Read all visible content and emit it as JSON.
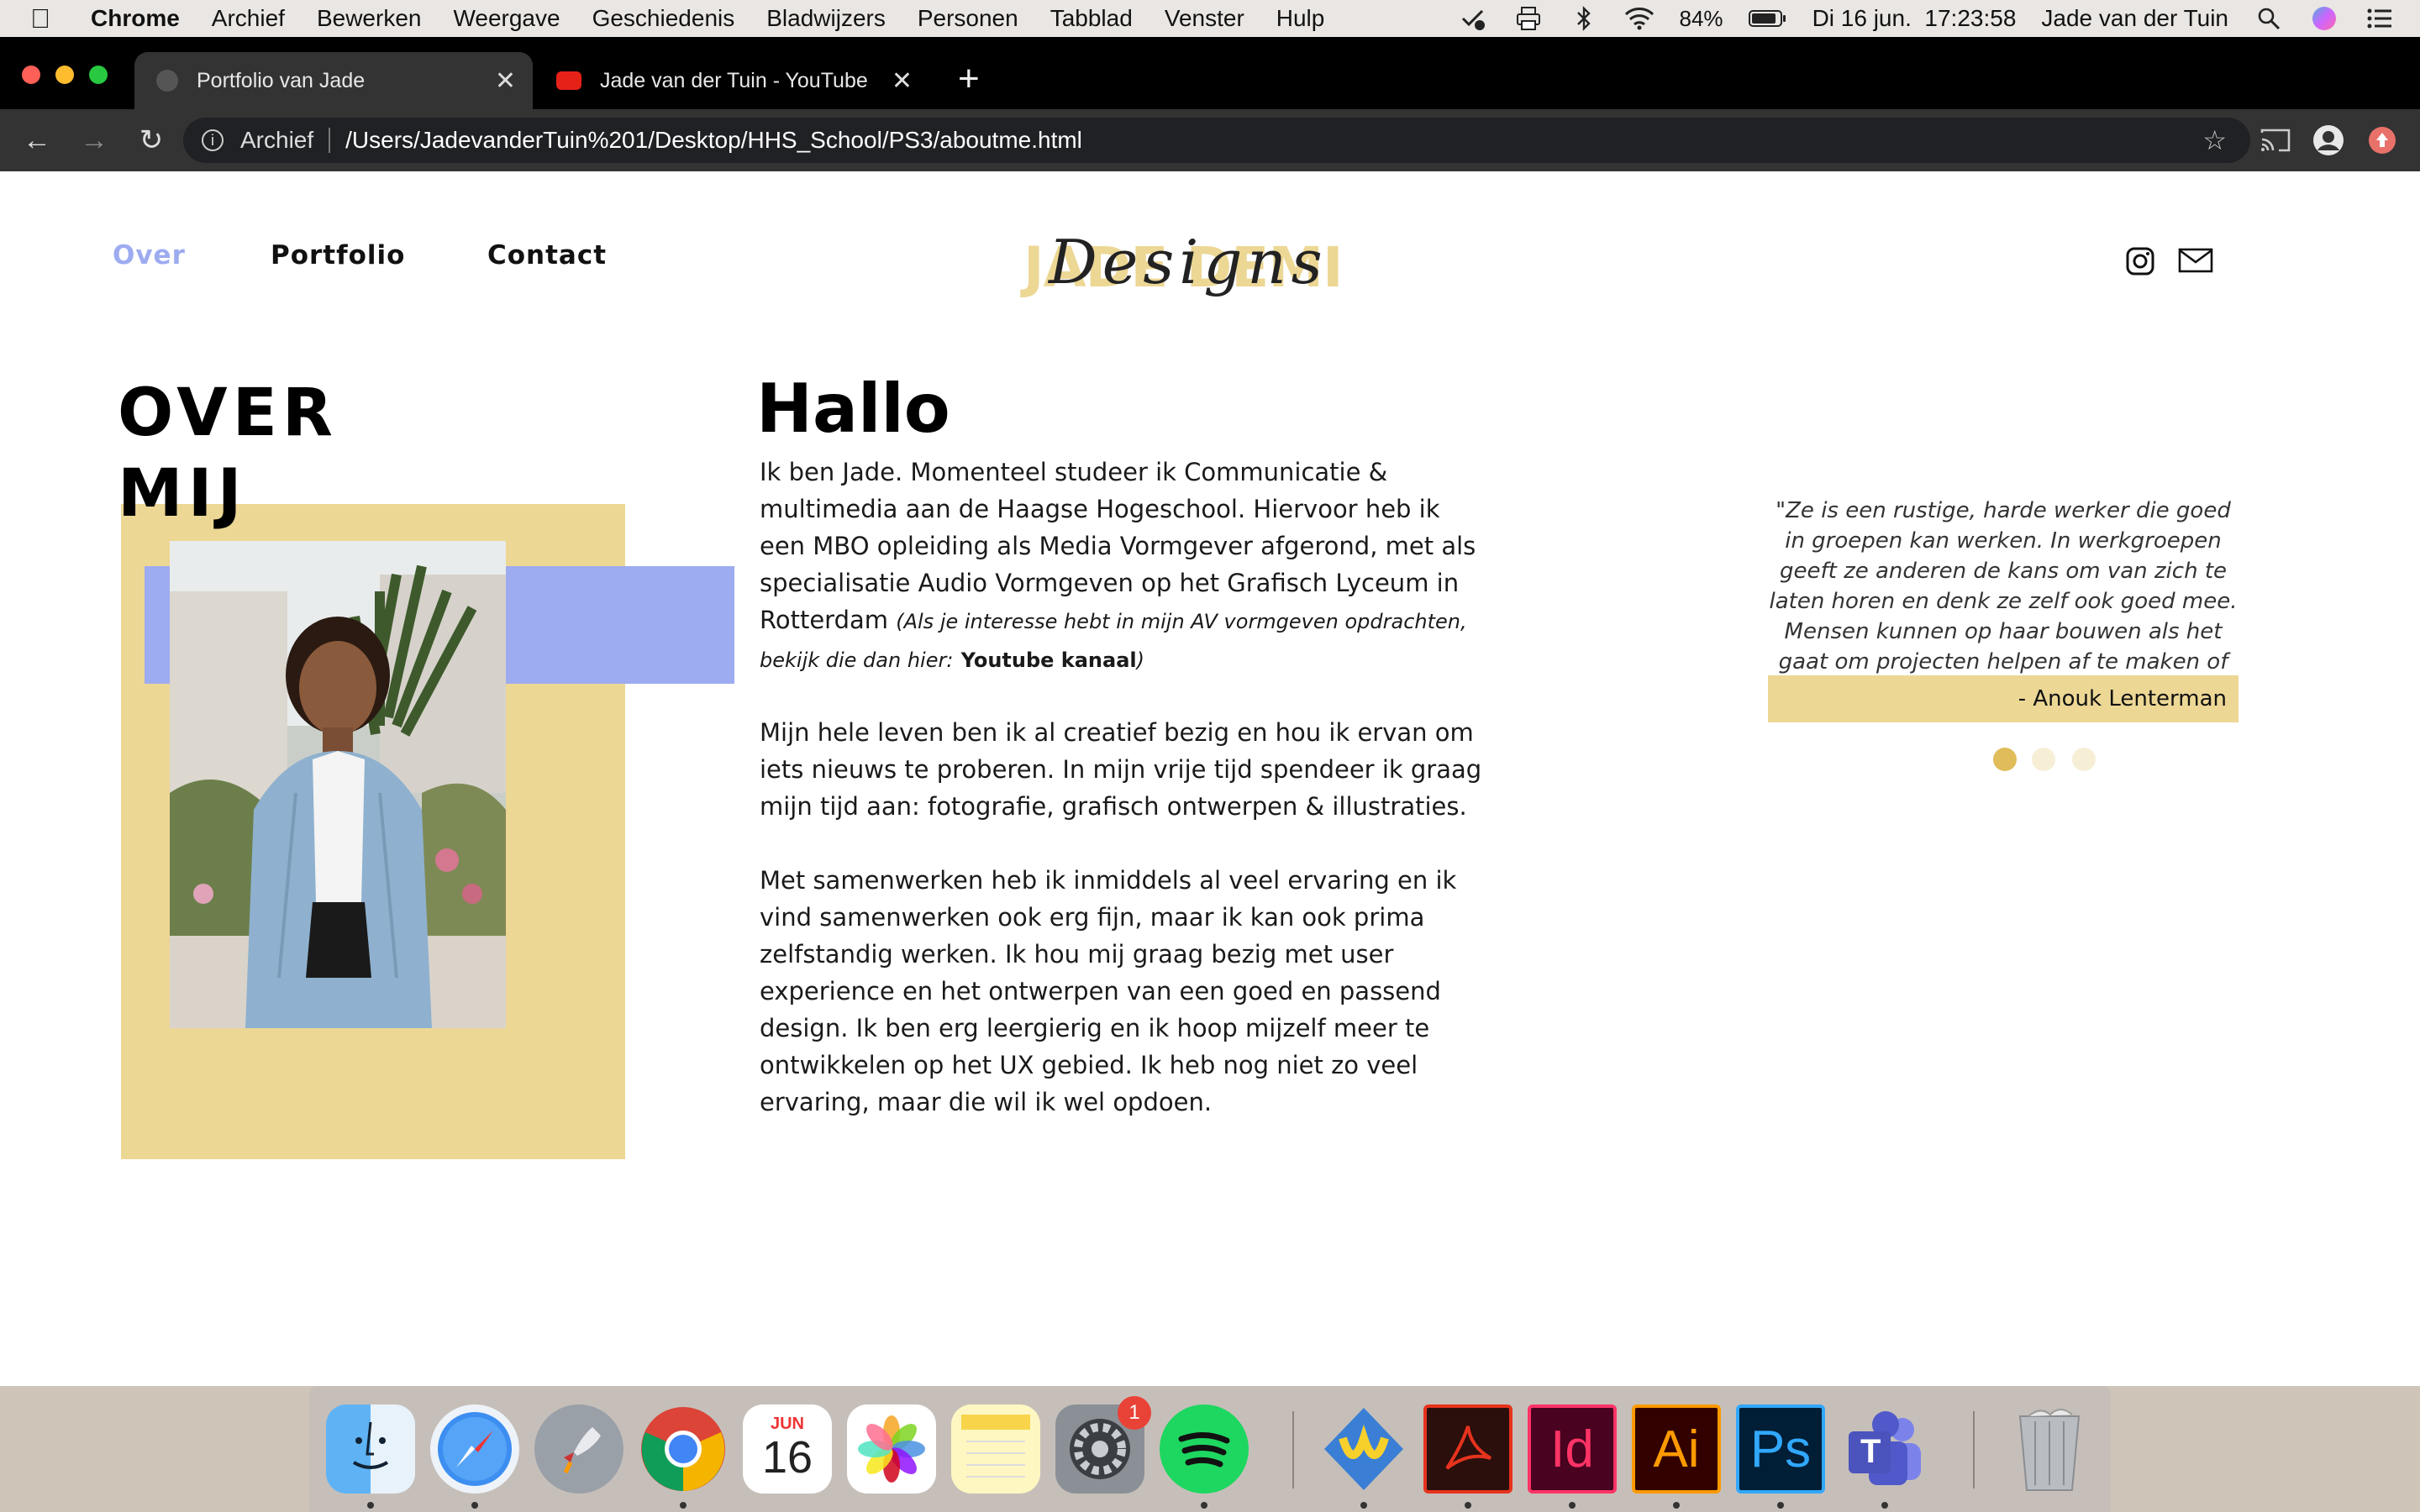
{
  "menubar": {
    "app": "Chrome",
    "items": [
      "Archief",
      "Bewerken",
      "Weergave",
      "Geschiedenis",
      "Bladwijzers",
      "Personen",
      "Tabblad",
      "Venster",
      "Hulp"
    ],
    "battery": "84%",
    "datetime": "Di 16 jun.  17:23:58",
    "user": "Jade van der Tuin"
  },
  "browser": {
    "tabs": [
      {
        "title": "Portfolio van Jade",
        "active": true
      },
      {
        "title": "Jade van der Tuin - YouTube",
        "active": false
      }
    ],
    "address": {
      "label": "Archief",
      "url": "/Users/JadevanderTuin%201/Desktop/HHS_School/PS3/aboutme.html"
    }
  },
  "site": {
    "nav": {
      "over": "Over",
      "portfolio": "Portfolio",
      "contact": "Contact"
    },
    "logo": {
      "back": "JADE DEMI",
      "script": "Designs"
    },
    "about": {
      "heading_line1": "OVER",
      "heading_line2": "MIJ",
      "greeting": "Hallo",
      "intro": "Ik ben Jade. Momenteel studeer ik Communicatie & multimedia aan de Haagse Hogeschool. Hiervoor heb ik een MBO opleiding als Media Vormgever afgerond, met als specialisatie Audio Vormgeven op het Grafisch Lyceum in Rotterdam",
      "note": "(Als je interesse hebt in mijn AV vormgeven opdrachten, bekijk die dan hier:",
      "youtube_link": "Youtube kanaal",
      "note_end": ")",
      "paragraph2": "Mijn hele leven ben ik al creatief bezig en hou ik ervan om iets nieuws te proberen. In mijn vrije tijd spendeer ik graag mijn tijd aan: fotografie, grafisch ontwerpen & illustraties.",
      "paragraph3": "Met samenwerken heb ik inmiddels al veel ervaring en ik vind samenwerken ook erg fijn, maar ik kan ook prima zelfstandig werken. Ik hou mij graag bezig met user experience en het ontwerpen van een goed en passend design. Ik ben erg leergierig en ik hoop mijzelf meer te ontwikkelen op het UX gebied. Ik heb nog niet zo veel ervaring, maar die wil ik wel opdoen."
    },
    "testimonial": {
      "quote": "\"Ze is een rustige, harde werker die goed in groepen kan werken. In werkgroepen geeft ze anderen de kans om van zich te laten horen en denk ze zelf ook goed mee. Mensen kunnen op haar bouwen als het gaat om projecten helpen af te maken of deadlines te halen.\"",
      "author": "- Anouk Lenterman",
      "active_index": 0,
      "count": 3
    }
  },
  "dock": {
    "calendar_month": "JUN",
    "calendar_day": "16",
    "preferences_badge": "1",
    "apps": [
      "finder-icon",
      "safari-icon",
      "launchpad-icon",
      "chrome-icon",
      "calendar-icon",
      "photos-icon",
      "notes-icon",
      "system-preferences-icon",
      "spotify-icon",
      "jedit-icon",
      "acrobat-icon",
      "indesign-icon",
      "illustrator-icon",
      "photoshop-icon",
      "teams-icon",
      "trash-icon"
    ],
    "labels": {
      "indesign": "Id",
      "illustrator": "Ai",
      "photoshop": "Ps",
      "teams": "T"
    }
  },
  "colors": {
    "accent_yellow": "#ecd795",
    "accent_blue": "#9dabf0",
    "nav_active": "#9dabf0",
    "dot_active": "#e0bd5a",
    "dot_inactive": "#f6efd6"
  }
}
